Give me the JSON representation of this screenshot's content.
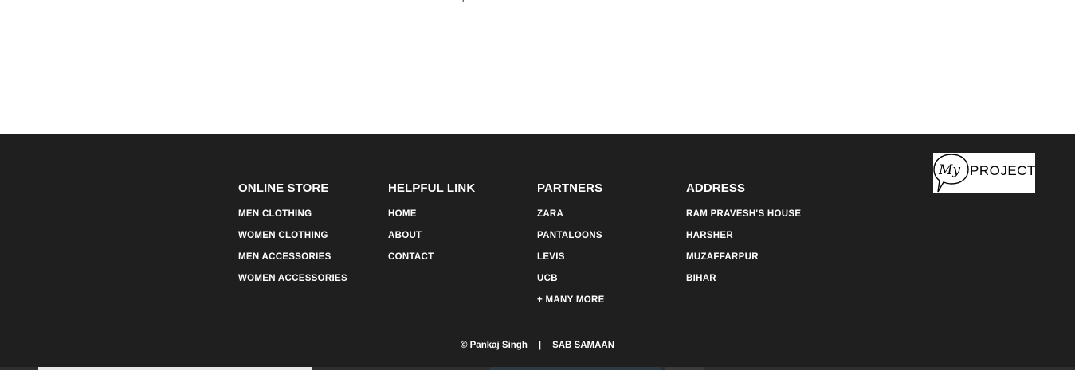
{
  "footer": {
    "columns": [
      {
        "title": "ONLINE STORE",
        "items": [
          "MEN CLOTHING",
          "WOMEN CLOTHING",
          "MEN ACCESSORIES",
          "WOMEN ACCESSORIES"
        ]
      },
      {
        "title": "HELPFUL LINK",
        "items": [
          "HOME",
          "ABOUT",
          "CONTACT"
        ]
      },
      {
        "title": "PARTNERS",
        "items": [
          "ZARA",
          "PANTALOONS",
          "LEVIS",
          "UCB",
          "+ MANY MORE"
        ]
      },
      {
        "title": "ADDRESS",
        "items": [
          "RAM PRAVESH'S HOUSE",
          "HARSHER",
          "MUZAFFARPUR",
          "BIHAR"
        ]
      }
    ],
    "copyright": "© Pankaj Singh",
    "separator": "|",
    "brand": "SAB SAMAAN",
    "logo": {
      "script_text": "My",
      "text": "PROJECT"
    }
  },
  "colors": {
    "footer_bg": "#1f1f1f",
    "text": "#ffffff"
  }
}
